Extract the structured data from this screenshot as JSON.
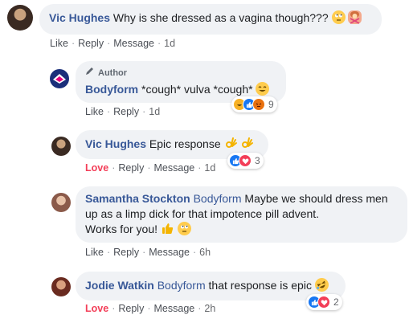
{
  "comments": [
    {
      "name": "Vic Hughes",
      "text": "Why is she dressed as a vagina though???",
      "actions": [
        "Like",
        "Reply",
        "Message",
        "1d"
      ]
    },
    {
      "badge": "Author",
      "name": "Bodyform",
      "text": "*cough* vulva *cough*",
      "actions": [
        "Like",
        "Reply",
        "1d"
      ],
      "reaction_count": "9"
    },
    {
      "name": "Vic Hughes",
      "text": "Epic response",
      "actions": [
        "Love",
        "Reply",
        "Message",
        "1d"
      ],
      "reaction_count": "3"
    },
    {
      "name": "Samantha Stockton",
      "tag": "Bodyform",
      "text_line1": "Maybe we should dress men",
      "text_line2": "up as a limp dick for that impotence pill advent.",
      "text_line3": "Works for you!",
      "actions": [
        "Like",
        "Reply",
        "Message",
        "6h"
      ]
    },
    {
      "name": "Jodie Watkin",
      "tag": "Bodyform",
      "text": "that response is epic",
      "actions": [
        "Love",
        "Reply",
        "Message",
        "2h"
      ],
      "reaction_count": "2"
    }
  ],
  "colors": {
    "name_blue": "#385898",
    "love_red": "#f33e58",
    "bubble_bg": "#f0f2f5",
    "like_blue": "#1877f2"
  },
  "icons": [
    "rolling-eyes-emoji",
    "woman-gesturing-no-emoji",
    "grinning-sweat-emoji",
    "ok-hand-emoji",
    "thumbs-up-emoji",
    "rofl-emoji",
    "pencil-icon",
    "like-reaction-icon",
    "love-reaction-icon",
    "haha-reaction-icon",
    "angry-reaction-icon"
  ]
}
